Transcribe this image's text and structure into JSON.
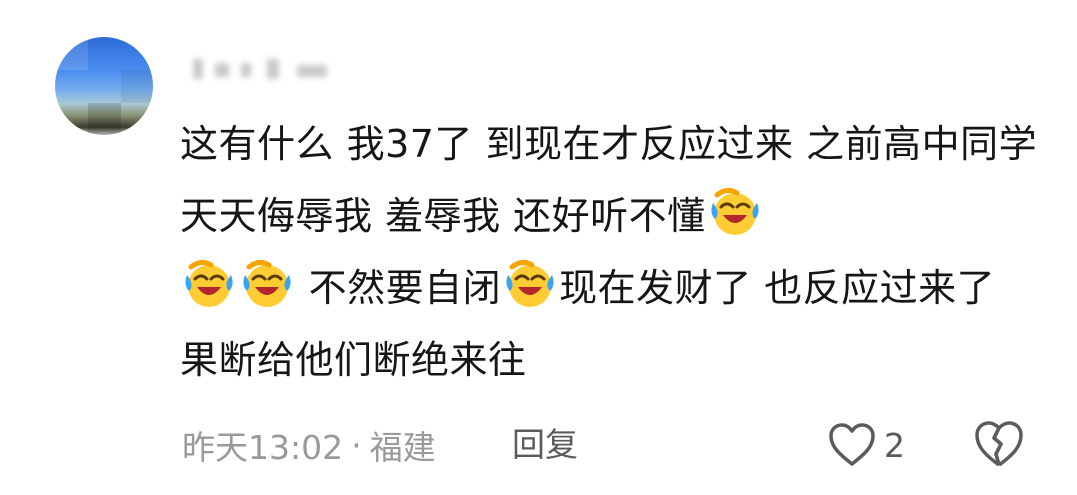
{
  "comment": {
    "username": "",
    "text_parts": [
      "这有什么 我37了 到现在才反应过来 之前高中同学天天侮辱我 羞辱我 还好听不懂",
      " 不然要自闭",
      "现在发财了 也反应过来了 果断给他们断绝来往"
    ],
    "emojis": [
      "laugh-cry-emoji",
      "laugh-cry-emoji",
      "laugh-cry-emoji",
      "laugh-cry-emoji"
    ],
    "time": "昨天13:02",
    "separator": "·",
    "location": "福建",
    "reply_label": "回复",
    "like_count": "2"
  },
  "icons": {
    "like": "heart-outline-icon",
    "dislike": "broken-heart-icon"
  },
  "colors": {
    "text": "#161616",
    "meta": "#9a9a9a",
    "action": "#5b5b5b",
    "emoji_face": "#ffcc33",
    "emoji_tear": "#3aa3f5",
    "emoji_mouth": "#b3262e"
  }
}
